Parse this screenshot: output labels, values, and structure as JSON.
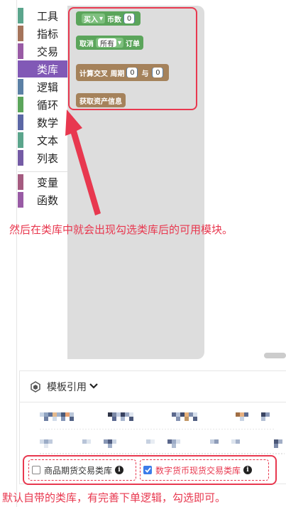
{
  "toolbox": {
    "categories": [
      {
        "label": "工具",
        "color": "#5ba58c"
      },
      {
        "label": "指标",
        "color": "#a5745b"
      },
      {
        "label": "交易",
        "color": "#995ba5"
      },
      {
        "label": "类库",
        "color": "#8159b6",
        "selected": true
      },
      {
        "label": "逻辑",
        "color": "#5b80a5"
      },
      {
        "label": "循环",
        "color": "#5ba55b"
      },
      {
        "label": "数学",
        "color": "#5b67a5"
      },
      {
        "label": "文本",
        "color": "#5ba58c"
      },
      {
        "label": "列表",
        "color": "#745ba5"
      },
      {
        "label": "变量",
        "color": "#a55b80"
      },
      {
        "label": "函数",
        "color": "#995ba5"
      }
    ]
  },
  "flyout": {
    "block_buy": {
      "action": "买入",
      "label": "币数",
      "value": "0"
    },
    "block_cancel": {
      "label": "取消",
      "option": "所有",
      "suffix": "订单"
    },
    "block_cross": {
      "label": "计算交叉 周期",
      "value1": "0",
      "joiner": "与",
      "value2": "0"
    },
    "block_asset": {
      "label": "获取资产信息"
    }
  },
  "annotations": {
    "top": "然后在类库中就会出现勾选类库后的可用模块。",
    "bottom": "默认自带的类库，有完善下单逻辑，勾选即可。"
  },
  "template_panel": {
    "title": "模板引用",
    "libraries": [
      {
        "label": "商品期货交易类库",
        "checked": false
      },
      {
        "label": "数字货币现货交易类库",
        "checked": true
      }
    ]
  },
  "colors": {
    "accent_red": "#e8384f",
    "selected_category": "#8159b6",
    "checkbox_blue": "#3b7de9"
  }
}
